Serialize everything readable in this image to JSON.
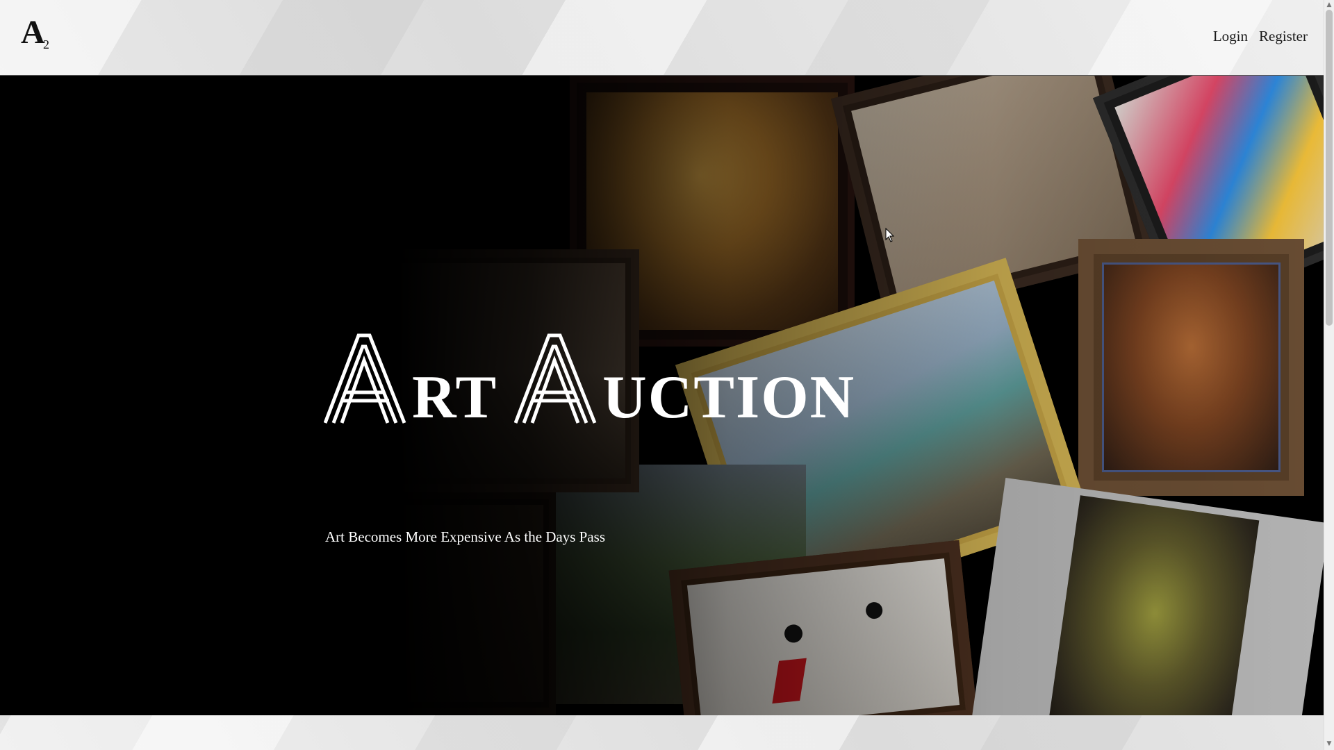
{
  "brand": {
    "logo_letter": "A",
    "logo_subscript": "2"
  },
  "nav": {
    "login": "Login",
    "register": "Register"
  },
  "hero": {
    "title_word1_initial": "A",
    "title_word1_rest": "RT",
    "title_word2_initial": "A",
    "title_word2_rest": "UCTION",
    "subtitle": "Art Becomes More Expensive As the Days Pass"
  },
  "icons": {
    "logo": "a2-logo-icon",
    "cursor": "mouse-pointer-icon",
    "scroll_up": "chevron-up-icon",
    "scroll_down": "chevron-down-icon"
  },
  "colors": {
    "hero_background": "#000000",
    "hero_text": "#ffffff",
    "nav_text": "#1a1a1a",
    "page_background": "#e8e8e8"
  }
}
